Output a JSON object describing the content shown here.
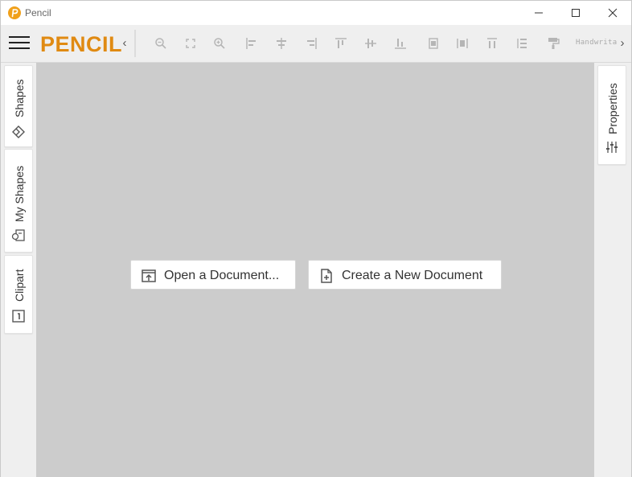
{
  "window": {
    "title": "Pencil",
    "controls": {
      "minimize_icon": "minimize-icon",
      "maximize_icon": "maximize-icon",
      "close_icon": "close-icon"
    }
  },
  "toolbar": {
    "brand": "PENCIL",
    "collapse_arrow": "‹",
    "expand_arrow": "›",
    "font_name": "Handwrita",
    "tools": [
      "zoom-out-icon",
      "actual-size-icon",
      "zoom-in-icon",
      "align-left-icon",
      "align-center-icon",
      "align-right-icon",
      "align-top-icon",
      "align-middle-icon",
      "align-bottom-icon",
      "same-width-icon",
      "distribute-horizontal-icon",
      "same-height-icon",
      "distribute-vertical-icon",
      "format-painter-icon"
    ]
  },
  "left_panel": {
    "tabs": [
      {
        "label": "Shapes",
        "icon": "shapes-icon"
      },
      {
        "label": "My Shapes",
        "icon": "my-shapes-icon"
      },
      {
        "label": "Clipart",
        "icon": "clipart-icon"
      }
    ]
  },
  "right_panel": {
    "tabs": [
      {
        "label": "Properties",
        "icon": "properties-sliders-icon"
      }
    ]
  },
  "canvas": {
    "open_button": "Open a Document...",
    "create_button": "Create a New Document"
  },
  "colors": {
    "brand": "#e08a12",
    "canvas_bg": "#cccccc",
    "panel_bg": "#efefef"
  }
}
